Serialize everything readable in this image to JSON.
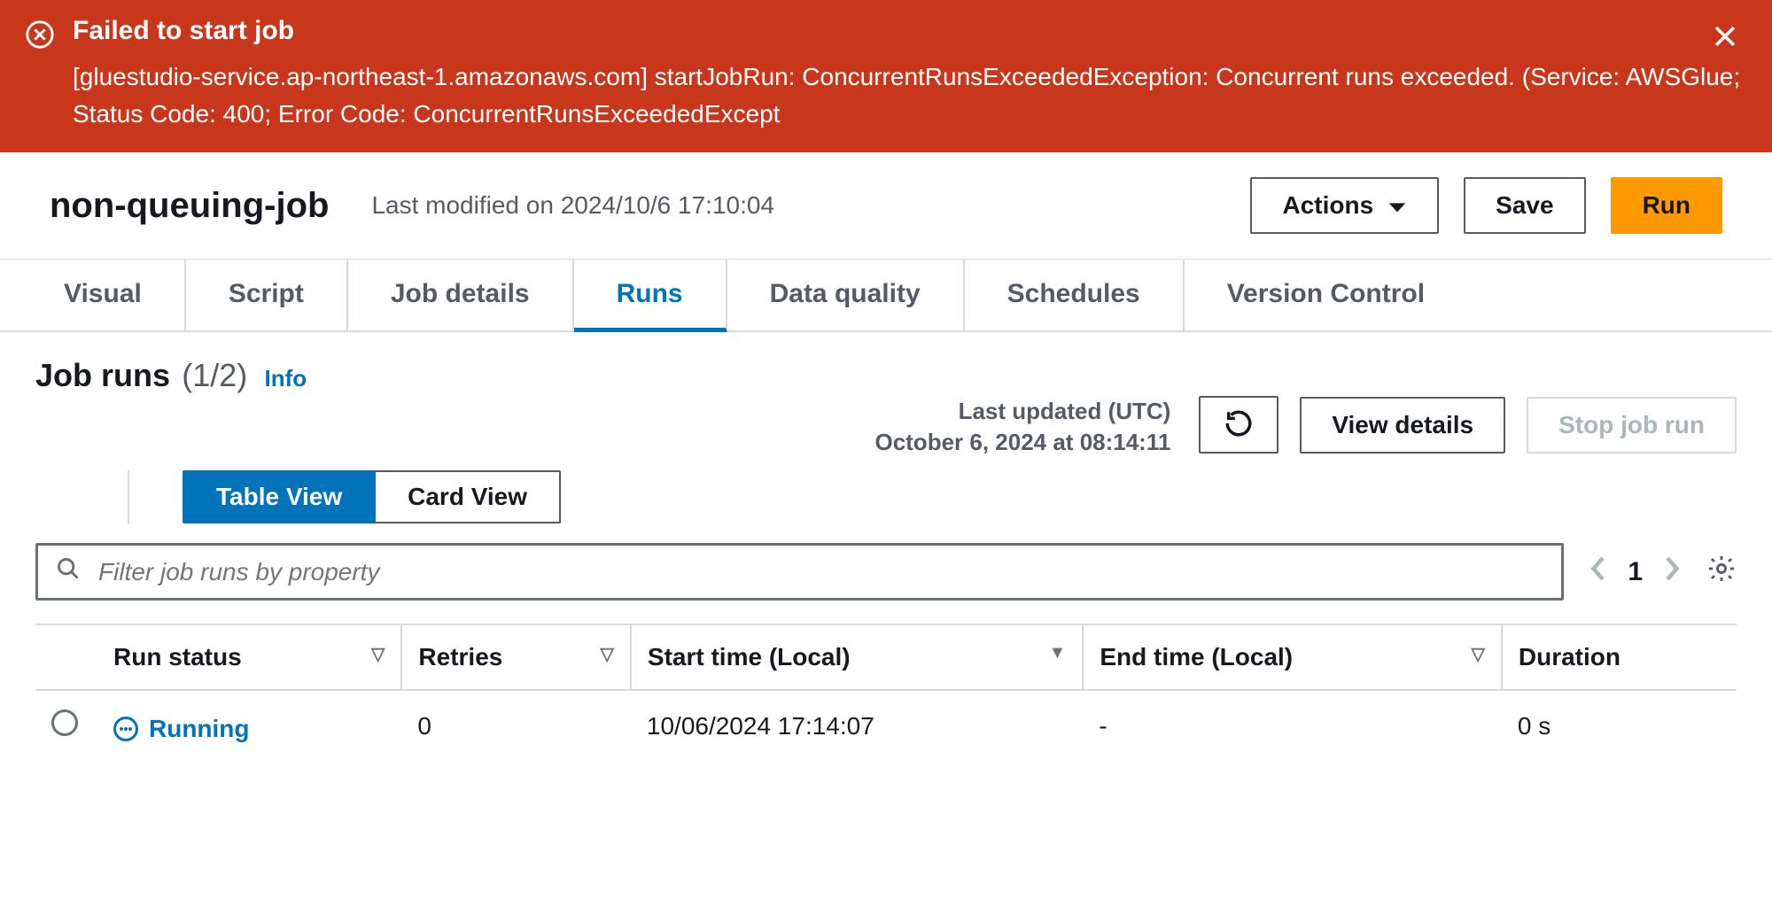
{
  "error": {
    "title": "Failed to start job",
    "message": "[gluestudio-service.ap-northeast-1.amazonaws.com] startJobRun: ConcurrentRunsExceededException: Concurrent runs exceeded. (Service: AWSGlue; Status Code: 400; Error Code: ConcurrentRunsExceededExcept"
  },
  "header": {
    "job_name": "non-queuing-job",
    "last_modified": "Last modified on 2024/10/6 17:10:04",
    "actions_label": "Actions",
    "save_label": "Save",
    "run_label": "Run"
  },
  "tabs": {
    "items": [
      "Visual",
      "Script",
      "Job details",
      "Runs",
      "Data quality",
      "Schedules",
      "Version Control"
    ],
    "active": "Runs"
  },
  "runs_panel": {
    "title": "Job runs",
    "count": "(1/2)",
    "info_label": "Info",
    "last_updated_label": "Last updated (UTC)",
    "last_updated_value": "October 6, 2024 at 08:14:11",
    "view_details_label": "View details",
    "stop_label": "Stop job run",
    "view_toggle": {
      "table": "Table View",
      "card": "Card View",
      "active": "table"
    },
    "filter_placeholder": "Filter job runs by property",
    "page": "1"
  },
  "table": {
    "columns": {
      "run_status": "Run status",
      "retries": "Retries",
      "start_time": "Start time (Local)",
      "end_time": "End time (Local)",
      "duration": "Duration"
    },
    "rows": [
      {
        "status": "Running",
        "retries": "0",
        "start_time": "10/06/2024 17:14:07",
        "end_time": "-",
        "duration": "0 s"
      }
    ]
  }
}
